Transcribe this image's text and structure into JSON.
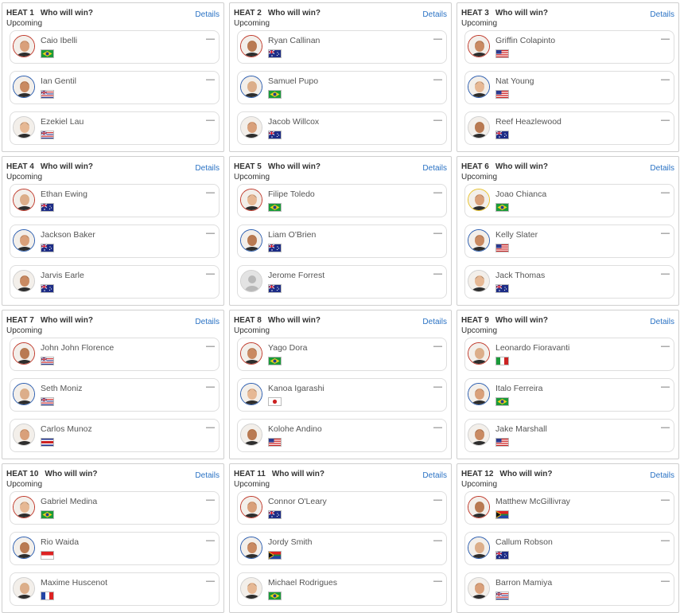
{
  "heats": [
    {
      "label": "HEAT 1",
      "question": "Who will win?",
      "status": "Upcoming",
      "details": "Details",
      "surfers": [
        {
          "name": "Caio Ibelli",
          "flag": "BR",
          "result": "—",
          "ring": "red",
          "icon": "surfer-avatar-icon"
        },
        {
          "name": "Ian Gentil",
          "flag": "HAW",
          "result": "—",
          "ring": "blue",
          "icon": "surfer-avatar-icon"
        },
        {
          "name": "Ezekiel Lau",
          "flag": "HAW",
          "result": "—",
          "ring": "none",
          "icon": "surfer-avatar-icon"
        }
      ]
    },
    {
      "label": "HEAT 2",
      "question": "Who will win?",
      "status": "Upcoming",
      "details": "Details",
      "surfers": [
        {
          "name": "Ryan Callinan",
          "flag": "AU",
          "result": "—",
          "ring": "red",
          "icon": "surfer-avatar-icon"
        },
        {
          "name": "Samuel Pupo",
          "flag": "BR",
          "result": "—",
          "ring": "blue",
          "icon": "surfer-avatar-icon"
        },
        {
          "name": "Jacob Willcox",
          "flag": "AU",
          "result": "—",
          "ring": "none",
          "icon": "surfer-avatar-icon"
        }
      ]
    },
    {
      "label": "HEAT 3",
      "question": "Who will win?",
      "status": "Upcoming",
      "details": "Details",
      "surfers": [
        {
          "name": "Griffin Colapinto",
          "flag": "US",
          "result": "—",
          "ring": "red",
          "icon": "surfer-avatar-icon"
        },
        {
          "name": "Nat Young",
          "flag": "US",
          "result": "—",
          "ring": "blue",
          "icon": "surfer-avatar-icon"
        },
        {
          "name": "Reef Heazlewood",
          "flag": "AU",
          "result": "—",
          "ring": "none",
          "icon": "surfer-avatar-icon"
        }
      ]
    },
    {
      "label": "HEAT 4",
      "question": "Who will win?",
      "status": "Upcoming",
      "details": "Details",
      "surfers": [
        {
          "name": "Ethan Ewing",
          "flag": "AU",
          "result": "—",
          "ring": "red",
          "icon": "surfer-avatar-icon"
        },
        {
          "name": "Jackson Baker",
          "flag": "AU",
          "result": "—",
          "ring": "blue",
          "icon": "surfer-avatar-icon"
        },
        {
          "name": "Jarvis Earle",
          "flag": "AU",
          "result": "—",
          "ring": "none",
          "icon": "surfer-avatar-icon"
        }
      ]
    },
    {
      "label": "HEAT 5",
      "question": "Who will win?",
      "status": "Upcoming",
      "details": "Details",
      "surfers": [
        {
          "name": "Filipe Toledo",
          "flag": "BR",
          "result": "—",
          "ring": "red",
          "icon": "surfer-avatar-icon"
        },
        {
          "name": "Liam O'Brien",
          "flag": "AU",
          "result": "—",
          "ring": "blue",
          "icon": "surfer-avatar-icon"
        },
        {
          "name": "Jerome Forrest",
          "flag": "AU",
          "result": "—",
          "ring": "none",
          "icon": "placeholder-avatar-icon"
        }
      ]
    },
    {
      "label": "HEAT 6",
      "question": "Who will win?",
      "status": "Upcoming",
      "details": "Details",
      "surfers": [
        {
          "name": "Joao Chianca",
          "flag": "BR",
          "result": "—",
          "ring": "yellow",
          "icon": "surfer-avatar-icon"
        },
        {
          "name": "Kelly Slater",
          "flag": "US",
          "result": "—",
          "ring": "blue",
          "icon": "surfer-avatar-icon"
        },
        {
          "name": "Jack Thomas",
          "flag": "AU",
          "result": "—",
          "ring": "none",
          "icon": "surfer-avatar-icon"
        }
      ]
    },
    {
      "label": "HEAT 7",
      "question": "Who will win?",
      "status": "Upcoming",
      "details": "Details",
      "surfers": [
        {
          "name": "John John Florence",
          "flag": "HAW",
          "result": "—",
          "ring": "red",
          "icon": "surfer-avatar-icon"
        },
        {
          "name": "Seth Moniz",
          "flag": "HAW",
          "result": "—",
          "ring": "blue",
          "icon": "surfer-avatar-icon"
        },
        {
          "name": "Carlos Munoz",
          "flag": "CR",
          "result": "—",
          "ring": "none",
          "icon": "surfer-avatar-icon"
        }
      ]
    },
    {
      "label": "HEAT 8",
      "question": "Who will win?",
      "status": "Upcoming",
      "details": "Details",
      "surfers": [
        {
          "name": "Yago Dora",
          "flag": "BR",
          "result": "—",
          "ring": "red",
          "icon": "surfer-avatar-icon"
        },
        {
          "name": "Kanoa Igarashi",
          "flag": "JP",
          "result": "—",
          "ring": "blue",
          "icon": "surfer-avatar-icon"
        },
        {
          "name": "Kolohe Andino",
          "flag": "US",
          "result": "—",
          "ring": "none",
          "icon": "surfer-avatar-icon"
        }
      ]
    },
    {
      "label": "HEAT 9",
      "question": "Who will win?",
      "status": "Upcoming",
      "details": "Details",
      "surfers": [
        {
          "name": "Leonardo Fioravanti",
          "flag": "IT",
          "result": "—",
          "ring": "red",
          "icon": "surfer-avatar-icon"
        },
        {
          "name": "Italo Ferreira",
          "flag": "BR",
          "result": "—",
          "ring": "blue",
          "icon": "surfer-avatar-icon"
        },
        {
          "name": "Jake Marshall",
          "flag": "US",
          "result": "—",
          "ring": "none",
          "icon": "surfer-avatar-icon"
        }
      ]
    },
    {
      "label": "HEAT 10",
      "question": "Who will win?",
      "status": "Upcoming",
      "details": "Details",
      "surfers": [
        {
          "name": "Gabriel Medina",
          "flag": "BR",
          "result": "—",
          "ring": "red",
          "icon": "surfer-avatar-icon"
        },
        {
          "name": "Rio Waida",
          "flag": "ID",
          "result": "—",
          "ring": "blue",
          "icon": "surfer-avatar-icon"
        },
        {
          "name": "Maxime Huscenot",
          "flag": "FR",
          "result": "—",
          "ring": "none",
          "icon": "surfer-avatar-icon"
        }
      ]
    },
    {
      "label": "HEAT 11",
      "question": "Who will win?",
      "status": "Upcoming",
      "details": "Details",
      "surfers": [
        {
          "name": "Connor O'Leary",
          "flag": "AU",
          "result": "—",
          "ring": "red",
          "icon": "surfer-avatar-icon"
        },
        {
          "name": "Jordy Smith",
          "flag": "ZA",
          "result": "—",
          "ring": "blue",
          "icon": "surfer-avatar-icon"
        },
        {
          "name": "Michael Rodrigues",
          "flag": "BR",
          "result": "—",
          "ring": "none",
          "icon": "surfer-avatar-icon"
        }
      ]
    },
    {
      "label": "HEAT 12",
      "question": "Who will win?",
      "status": "Upcoming",
      "details": "Details",
      "surfers": [
        {
          "name": "Matthew McGillivray",
          "flag": "ZA",
          "result": "—",
          "ring": "red",
          "icon": "surfer-avatar-icon"
        },
        {
          "name": "Callum Robson",
          "flag": "AU",
          "result": "—",
          "ring": "blue",
          "icon": "surfer-avatar-icon"
        },
        {
          "name": "Barron Mamiya",
          "flag": "HAW",
          "result": "—",
          "ring": "none",
          "icon": "surfer-avatar-icon"
        }
      ]
    }
  ],
  "colors": {
    "link": "#2a72c4",
    "ring_red": "#c0392b",
    "ring_blue": "#2a5db0",
    "ring_yellow": "#e8c22a",
    "border": "#cfcfcf"
  }
}
